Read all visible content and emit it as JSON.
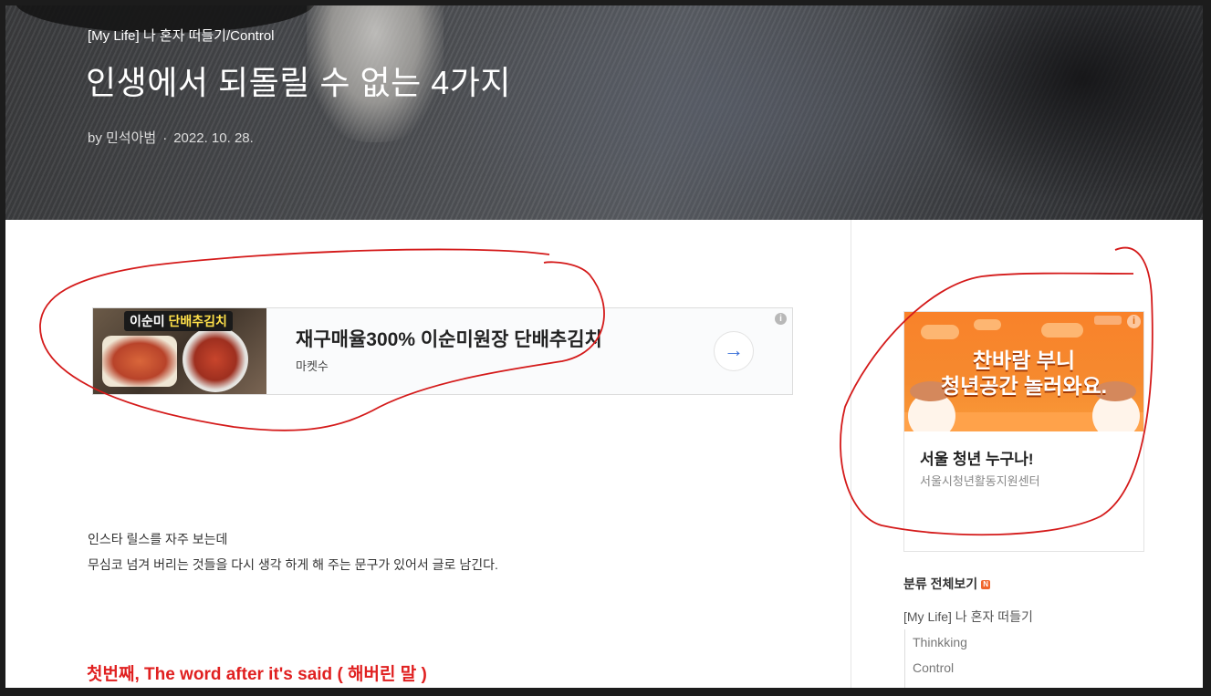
{
  "post": {
    "category": "[My Life] 나 혼자 떠들기/Control",
    "title": "인생에서 되돌릴 수 없는 4가지",
    "author": "by 민석아범",
    "separator": "·",
    "date": "2022. 10. 28."
  },
  "ad_main": {
    "thumb_badge_part1": "이순미",
    "thumb_badge_part2": "단배추김치",
    "headline": "재구매율300% 이순미원장 단배추김치",
    "advertiser": "마켓수",
    "go_icon": "→",
    "info_icon": "i"
  },
  "content": {
    "paragraph1": "인스타 릴스를 자주 보는데",
    "paragraph2": "무심코 넘겨 버리는 것들을 다시 생각 하게 해 주는 문구가 있어서 글로 남긴다.",
    "section1_heading": "첫번째, The word after it's said ( 해버린 말 )"
  },
  "ad_side": {
    "banner_line1": "찬바람 부니",
    "banner_line2": "청년공간 놀러와요.",
    "title": "서울 청년 누구나!",
    "subtitle": "서울시청년활동지원센터",
    "info_icon": "i"
  },
  "sidebar": {
    "category_heading": "분류 전체보기",
    "new_badge": "N",
    "categories": [
      {
        "label": "[My Life] 나 혼자 떠들기"
      },
      {
        "label": "Thinkking"
      },
      {
        "label": "Control"
      }
    ]
  },
  "colors": {
    "annotation_red": "#d41a1a",
    "section_heading": "#e02020",
    "banner_orange": "#f9822a",
    "new_badge": "#f0652b"
  }
}
